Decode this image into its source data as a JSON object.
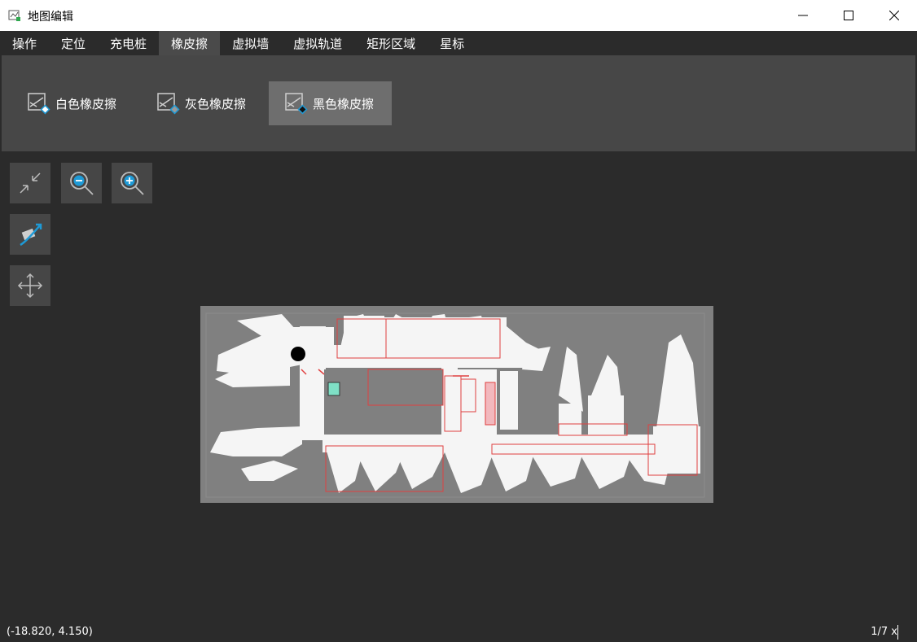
{
  "window": {
    "title": "地图编辑",
    "minimize_glyph": "—",
    "maximize_glyph": "☐",
    "close_glyph": "✕"
  },
  "menu": {
    "items": [
      {
        "label": "操作"
      },
      {
        "label": "定位"
      },
      {
        "label": "充电桩"
      },
      {
        "label": "橡皮擦",
        "active": true
      },
      {
        "label": "虚拟墙"
      },
      {
        "label": "虚拟轨道"
      },
      {
        "label": "矩形区域"
      },
      {
        "label": "星标"
      }
    ]
  },
  "ribbon": {
    "erasers": [
      {
        "label": "白色橡皮擦",
        "icon": "white-eraser-icon",
        "selected": false
      },
      {
        "label": "灰色橡皮擦",
        "icon": "gray-eraser-icon",
        "selected": false
      },
      {
        "label": "黑色橡皮擦",
        "icon": "black-eraser-icon",
        "selected": true
      }
    ]
  },
  "tools": [
    {
      "name": "fit-view",
      "icon": "shrink-arrows-icon"
    },
    {
      "name": "zoom-out",
      "icon": "zoom-out-icon"
    },
    {
      "name": "zoom-in",
      "icon": "zoom-in-icon"
    },
    {
      "name": "rotate-map",
      "icon": "rotate-arrow-icon"
    },
    {
      "name": "move-map",
      "icon": "move-arrows-icon"
    }
  ],
  "status": {
    "coordinates": "(-18.820, 4.150)",
    "zoom": "1/7 x"
  },
  "colors": {
    "background": "#2b2b2b",
    "ribbon": "#474747",
    "selected": "#6e6e6e",
    "map_gray": "#808080",
    "free_space": "#f5f5f5",
    "region_red": "#e04040",
    "accent_blue": "#1e9ad6"
  }
}
